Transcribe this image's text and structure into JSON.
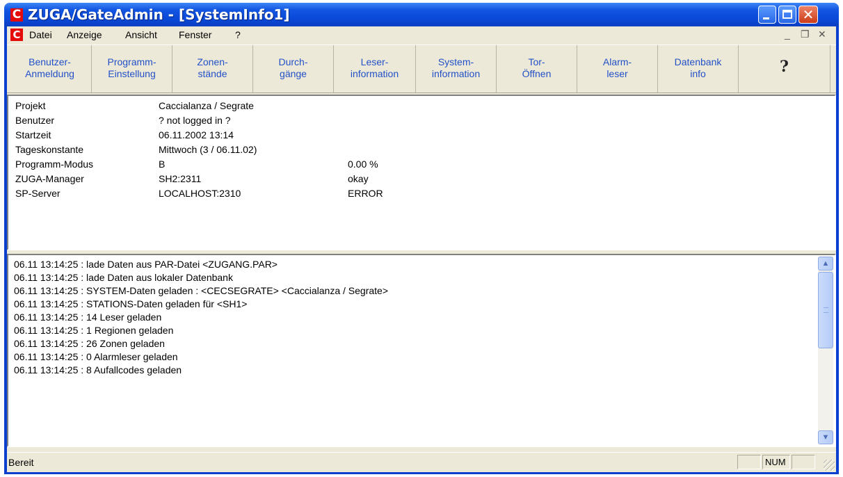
{
  "window": {
    "app_icon_letter": "C",
    "title": "ZUGA/GateAdmin - [SystemInfo1]",
    "controls": {
      "minimize": "_",
      "close": "✕"
    }
  },
  "menu": {
    "icon_letter": "C",
    "items": [
      "Datei",
      "Anzeige",
      "Ansicht",
      "Fenster",
      "?"
    ],
    "mdi_controls": {
      "minimize": "_",
      "restore": "❐",
      "close": "✕"
    }
  },
  "toolbar": {
    "buttons": [
      "Benutzer-\nAnmeldung",
      "Programm-\nEinstellung",
      "Zonen-\nstände",
      "Durch-\ngänge",
      "Leser-\ninformation",
      "System-\ninformation",
      "Tor-\nÖffnen",
      "Alarm-\nleser",
      "Datenbank\ninfo"
    ],
    "help_icon": "help-question-icon"
  },
  "info": {
    "rows": [
      {
        "label": "Projekt",
        "value": "Caccialanza / Segrate",
        "extra": ""
      },
      {
        "label": "Benutzer",
        "value": "? not logged in ?",
        "extra": ""
      },
      {
        "label": "Startzeit",
        "value": "06.11.2002 13:14",
        "extra": ""
      },
      {
        "label": "Tageskonstante",
        "value": "Mittwoch (3 / 06.11.02)",
        "extra": ""
      },
      {
        "label": "Programm-Modus",
        "value": "B",
        "extra": "0.00 %"
      },
      {
        "label": "ZUGA-Manager",
        "value": "SH2:2311",
        "extra": "okay"
      },
      {
        "label": "SP-Server",
        "value": "LOCALHOST:2310",
        "extra": "ERROR"
      }
    ]
  },
  "log": {
    "lines": [
      "06.11 13:14:25 : lade Daten aus PAR-Datei <ZUGANG.PAR>",
      "06.11 13:14:25 : lade Daten aus lokaler Datenbank",
      "06.11 13:14:25 : SYSTEM-Daten geladen : <CECSEGRATE> <Caccialanza / Segrate>",
      "06.11 13:14:25 : STATIONS-Daten geladen für <SH1>",
      "06.11 13:14:25 : 14 Leser geladen",
      "06.11 13:14:25 : 1 Regionen geladen",
      "06.11 13:14:25 : 26 Zonen geladen",
      "06.11 13:14:25 : 0 Alarmleser geladen",
      "06.11 13:14:25 : 8 Aufallcodes geladen"
    ]
  },
  "status": {
    "text": "Bereit",
    "panes": [
      "",
      "NUM",
      ""
    ]
  }
}
